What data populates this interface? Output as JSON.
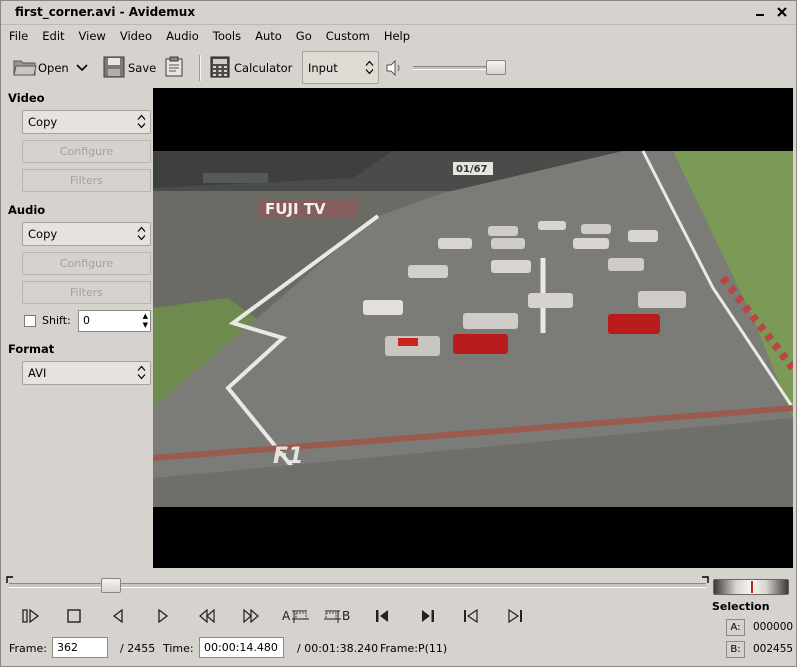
{
  "window": {
    "title": "first_corner.avi - Avidemux"
  },
  "menu": {
    "items": [
      {
        "label": "File"
      },
      {
        "label": "Edit"
      },
      {
        "label": "View"
      },
      {
        "label": "Video"
      },
      {
        "label": "Audio"
      },
      {
        "label": "Tools"
      },
      {
        "label": "Auto"
      },
      {
        "label": "Go"
      },
      {
        "label": "Custom"
      },
      {
        "label": "Help"
      }
    ]
  },
  "toolbar": {
    "open_label": "Open",
    "save_label": "Save",
    "calculator_label": "Calculator",
    "display_mode": "Input"
  },
  "left_panel": {
    "video_heading": "Video",
    "video_codec": "Copy",
    "video_configure": "Configure",
    "video_filters": "Filters",
    "audio_heading": "Audio",
    "audio_codec": "Copy",
    "audio_configure": "Configure",
    "audio_filters": "Filters",
    "shift_label": "Shift:",
    "shift_value": "0",
    "shift_checked": false,
    "format_heading": "Format",
    "format_value": "AVI"
  },
  "preview": {
    "overlay_text": "FUJI TV",
    "lap_text": "01/67"
  },
  "timeline": {
    "position_fraction": 0.147
  },
  "status": {
    "frame_label": "Frame:",
    "frame_value": "362",
    "total_frames": "/ 2455",
    "time_label": "Time:",
    "time_value": "00:00:14.480",
    "total_time": "/ 00:01:38.240",
    "frame_type": "Frame:P(11)"
  },
  "selection": {
    "heading": "Selection",
    "a_label": "A:",
    "a_value": "000000",
    "b_label": "B:",
    "b_value": "002455"
  },
  "colors": {
    "window_bg": "#d6d3ce",
    "video_bg": "#000000",
    "track_grass": "#6f8a4e",
    "asphalt": "#7b7b77"
  }
}
